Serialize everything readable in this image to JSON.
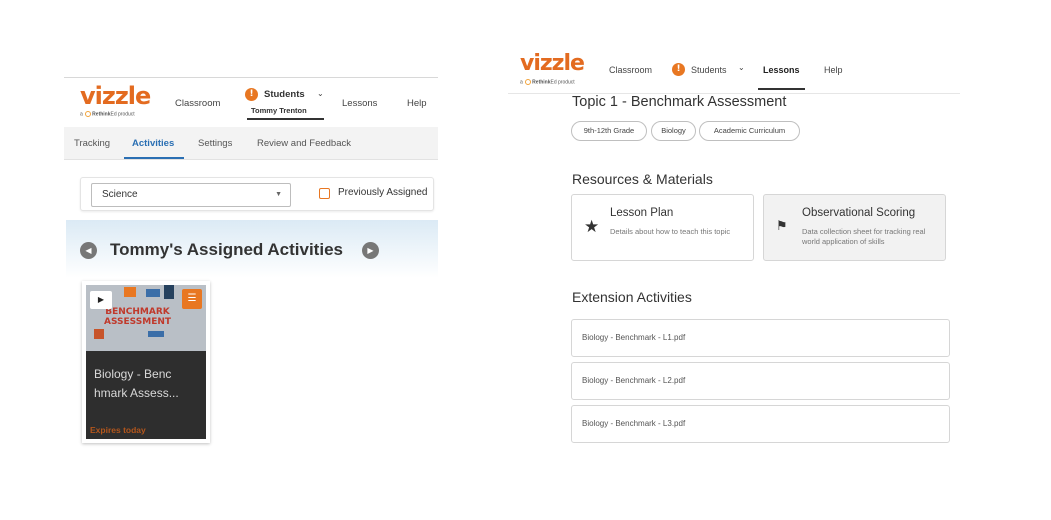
{
  "left": {
    "logo": "vizzle",
    "logo_sub": "a Rethink Ed product",
    "nav": {
      "classroom": "Classroom",
      "students": "Students",
      "student_name": "Tommy Trenton",
      "lessons": "Lessons",
      "help": "Help"
    },
    "tabs": [
      "Tracking",
      "Activities",
      "Settings",
      "Review and Feedback"
    ],
    "active_tab": "Activities",
    "subject_select": "Science",
    "previously_assigned": "Previously Assigned",
    "section_title": "Tommy's Assigned Activities",
    "card": {
      "thumb_text_line1": "BENCHMARK",
      "thumb_text_line2": "ASSESSMENT",
      "title": "Biology - Benchmark Assess...",
      "title_line1": "Biology - Benc",
      "title_line2": "hmark Assess...",
      "expiry": "Expires today"
    }
  },
  "right": {
    "logo": "vizzle",
    "logo_sub": "a Rethink Ed product",
    "nav": {
      "classroom": "Classroom",
      "students": "Students",
      "lessons": "Lessons",
      "help": "Help"
    },
    "topic_title": "Topic 1 - Benchmark Assessment",
    "tags": [
      "9th-12th Grade",
      "Biology",
      "Academic Curriculum"
    ],
    "resources_heading": "Resources & Materials",
    "resources": [
      {
        "title": "Lesson Plan",
        "description": "Details about how to teach this topic",
        "icon": "star-icon"
      },
      {
        "title": "Observational Scoring",
        "description": "Data collection sheet for tracking real world application of skills",
        "icon": "checkered-flag-icon"
      }
    ],
    "extension_heading": "Extension Activities",
    "extensions": [
      "Biology - Benchmark - L1.pdf",
      "Biology - Benchmark - L2.pdf",
      "Biology - Benchmark - L3.pdf"
    ]
  },
  "colors": {
    "brand_orange": "#e36b20",
    "accent_blue": "#2a6fb3",
    "alert_orange": "#e87722"
  }
}
